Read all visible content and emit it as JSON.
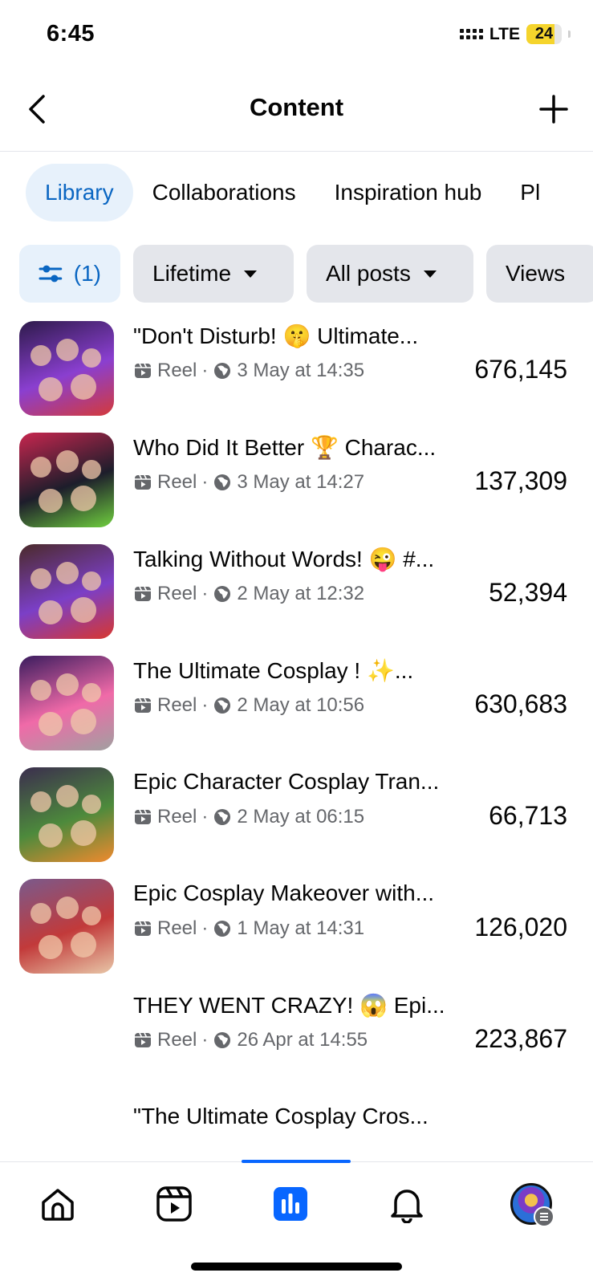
{
  "status_bar": {
    "time": "6:45",
    "network": "LTE",
    "battery": "24"
  },
  "header": {
    "title": "Content"
  },
  "tabs": [
    {
      "label": "Library",
      "active": true
    },
    {
      "label": "Collaborations",
      "active": false
    },
    {
      "label": "Inspiration hub",
      "active": false
    },
    {
      "label": "Pl",
      "active": false
    }
  ],
  "filters": {
    "adjust": {
      "label": "(1)",
      "icon": "sliders-icon"
    },
    "period": {
      "label": "Lifetime",
      "icon": "caret-down-icon"
    },
    "posts": {
      "label": "All posts",
      "icon": "caret-down-icon"
    },
    "metric": {
      "label": "Views"
    }
  },
  "posts": [
    {
      "title": "\"Don't Disturb! 🤫 Ultimate...",
      "type": "Reel",
      "date": "3 May at 14:35",
      "views": "676,145",
      "thumb": [
        "#2d1a4a",
        "#8a3fd0",
        "#d43a3a"
      ]
    },
    {
      "title": "Who Did It Better 🏆 Charac...",
      "type": "Reel",
      "date": "3 May at 14:27",
      "views": "137,309",
      "thumb": [
        "#c8264f",
        "#1d1d2b",
        "#6fcf3e"
      ]
    },
    {
      "title": "Talking Without Words! 😜 #...",
      "type": "Reel",
      "date": "2 May at 12:32",
      "views": "52,394",
      "thumb": [
        "#4b2a2a",
        "#7b3fc7",
        "#d8372f"
      ]
    },
    {
      "title": "The Ultimate Cosplay ! ✨...",
      "type": "Reel",
      "date": "2 May at 10:56",
      "views": "630,683",
      "thumb": [
        "#3a1c5e",
        "#f06aa8",
        "#a0a0a0"
      ]
    },
    {
      "title": "Epic Character Cosplay Tran...",
      "type": "Reel",
      "date": "2 May at 06:15",
      "views": "66,713",
      "thumb": [
        "#3b2d4e",
        "#4d8a3c",
        "#f08a2e"
      ]
    },
    {
      "title": "Epic Cosplay Makeover with...",
      "type": "Reel",
      "date": "1 May at 14:31",
      "views": "126,020",
      "thumb": [
        "#7a5a8c",
        "#c23a3a",
        "#e8c7a8"
      ]
    },
    {
      "title": "THEY WENT CRAZY! 😱 Epi...",
      "type": "Reel",
      "date": "26 Apr at 14:55",
      "views": "223,867",
      "thumb": null
    },
    {
      "title": "\"The Ultimate Cosplay Cros...",
      "type": "",
      "date": "",
      "views": "",
      "thumb": null
    }
  ],
  "bottom_nav": [
    {
      "name": "home-icon"
    },
    {
      "name": "reels-icon"
    },
    {
      "name": "insights-icon",
      "active": true
    },
    {
      "name": "notifications-icon"
    },
    {
      "name": "profile-avatar"
    }
  ],
  "colors": {
    "accent": "#0866ff",
    "active_tab_bg": "#e7f1fb",
    "active_text": "#0a66c2",
    "chip_bg": "#e4e6eb",
    "meta": "#65676b"
  }
}
